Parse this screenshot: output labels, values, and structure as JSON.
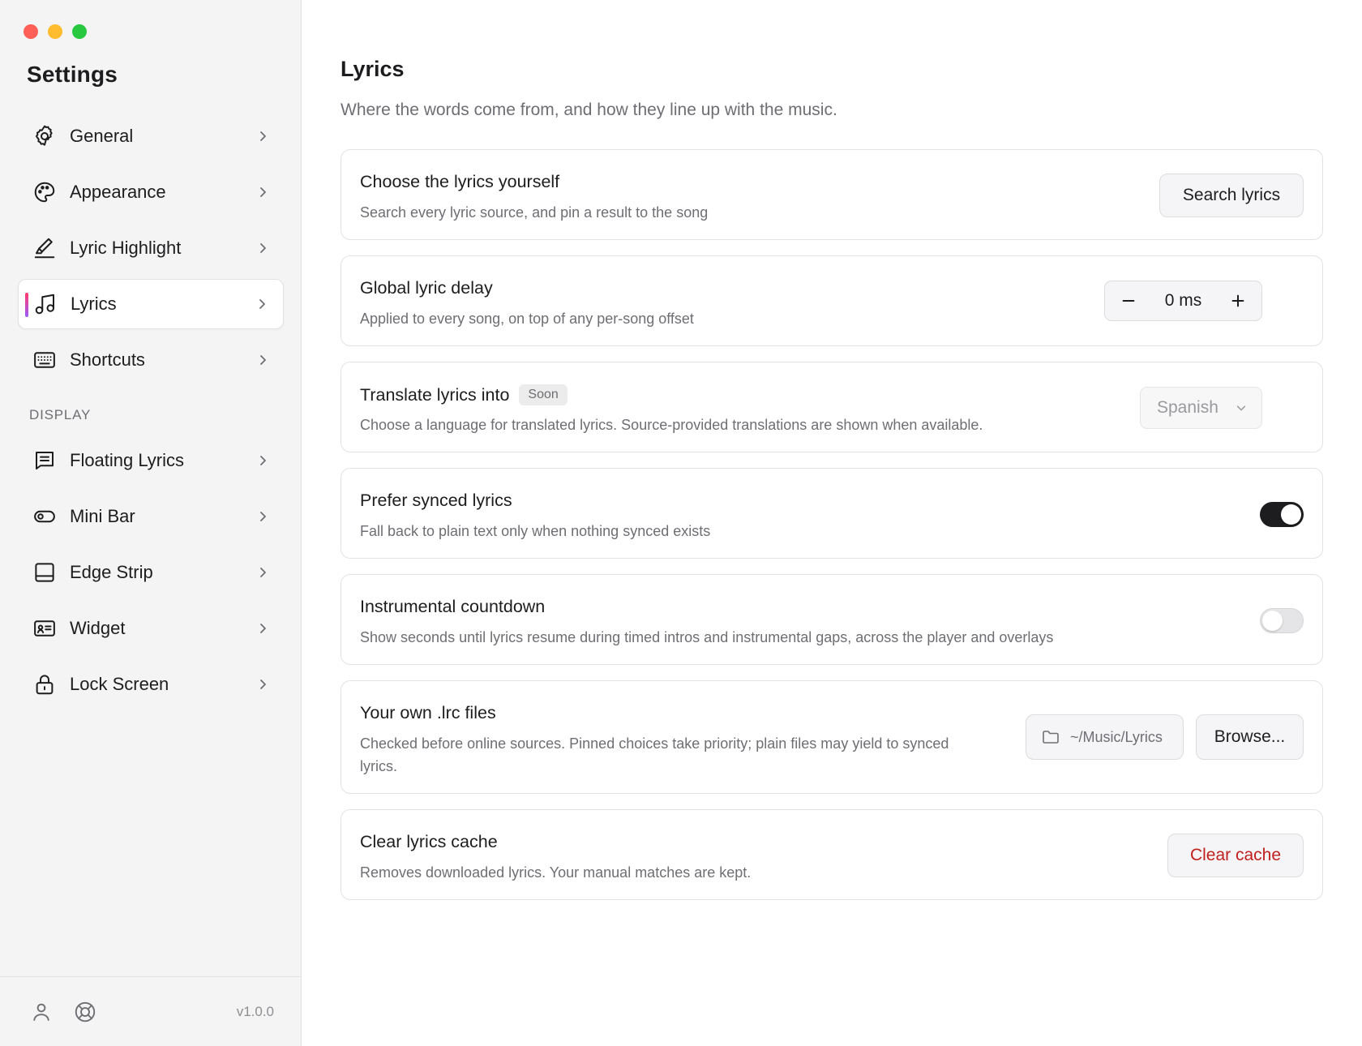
{
  "sidebar": {
    "title": "Settings",
    "items": [
      {
        "label": "General",
        "icon": "gear-icon"
      },
      {
        "label": "Appearance",
        "icon": "palette-icon"
      },
      {
        "label": "Lyric Highlight",
        "icon": "highlighter-icon"
      },
      {
        "label": "Lyrics",
        "icon": "music-note-icon",
        "active": true
      },
      {
        "label": "Shortcuts",
        "icon": "keyboard-icon"
      }
    ],
    "section_label": "DISPLAY",
    "display_items": [
      {
        "label": "Floating Lyrics",
        "icon": "message-text-icon"
      },
      {
        "label": "Mini Bar",
        "icon": "pill-icon"
      },
      {
        "label": "Edge Strip",
        "icon": "edge-strip-icon"
      },
      {
        "label": "Widget",
        "icon": "widget-card-icon"
      },
      {
        "label": "Lock Screen",
        "icon": "lock-icon"
      }
    ],
    "version": "v1.0.0"
  },
  "main": {
    "title": "Lyrics",
    "subtitle": "Where the words come from, and how they line up with the music.",
    "cards": {
      "choose": {
        "title": "Choose the lyrics yourself",
        "desc": "Search every lyric source, and pin a result to the song",
        "button": "Search lyrics"
      },
      "delay": {
        "title": "Global lyric delay",
        "desc": "Applied to every song, on top of any per-song offset",
        "value": "0 ms"
      },
      "translate": {
        "title": "Translate lyrics into",
        "badge": "Soon",
        "desc": "Choose a language for translated lyrics. Source-provided translations are shown when available.",
        "selected": "Spanish"
      },
      "synced": {
        "title": "Prefer synced lyrics",
        "desc": "Fall back to plain text only when nothing synced exists",
        "enabled": true
      },
      "countdown": {
        "title": "Instrumental countdown",
        "desc": "Show seconds until lyrics resume during timed intros and instrumental gaps, across the player and overlays",
        "enabled": false
      },
      "lrc": {
        "title": "Your own .lrc files",
        "desc_line1": "Checked before online sources. Pinned choices take priority; plain files may yield to synced",
        "desc_line2": "lyrics.",
        "path": "~/Music/Lyrics",
        "button": "Browse..."
      },
      "cache": {
        "title": "Clear lyrics cache",
        "desc": "Removes downloaded lyrics. Your manual matches are kept.",
        "button": "Clear cache"
      }
    }
  },
  "colors": {
    "danger": "#c0201d",
    "toggle_on": "#1d1d1f",
    "sidebar_bg": "#f4f4f4"
  }
}
